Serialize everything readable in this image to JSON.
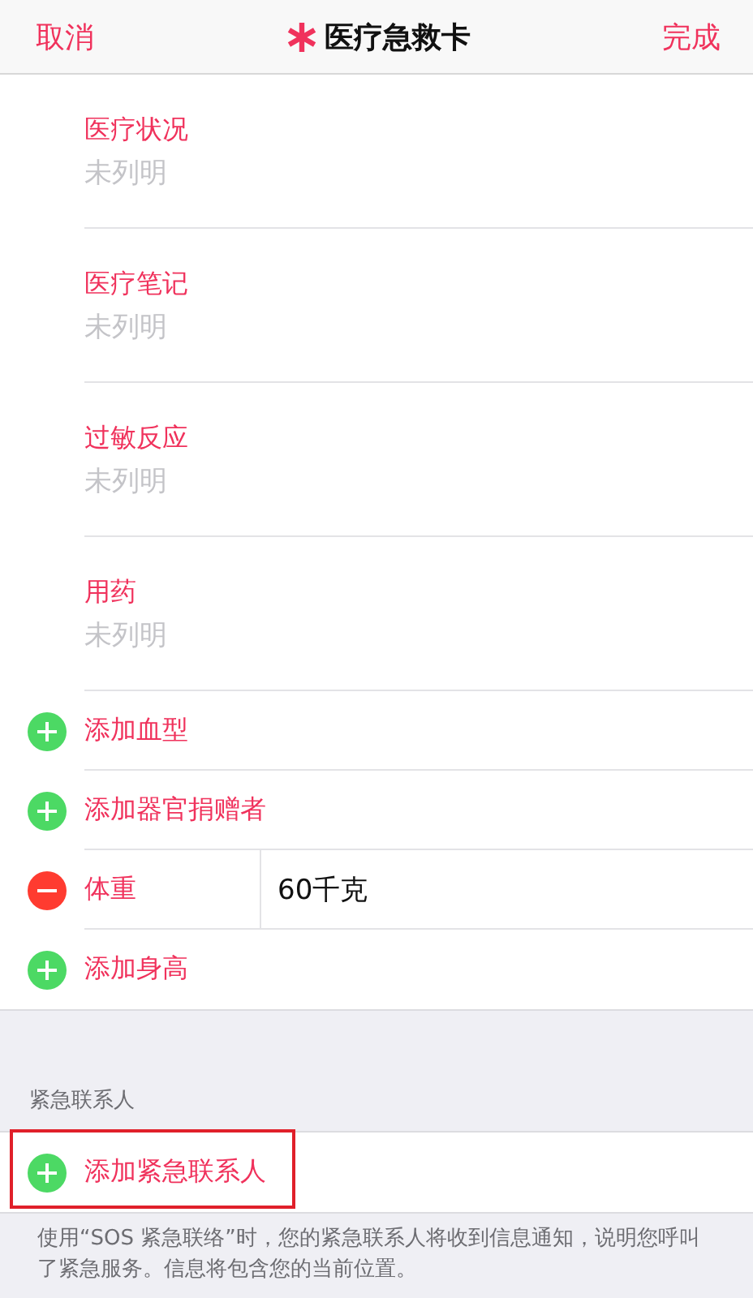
{
  "nav_bar": {
    "cancel": "取消",
    "title": "医疗急救卡",
    "done": "完成"
  },
  "fields": [
    {
      "label": "医疗状况",
      "placeholder": "未列明"
    },
    {
      "label": "医疗笔记",
      "placeholder": "未列明"
    },
    {
      "label": "过敏反应",
      "placeholder": "未列明"
    },
    {
      "label": "用药",
      "placeholder": "未列明"
    }
  ],
  "actions": [
    {
      "kind": "add",
      "label": "添加血型"
    },
    {
      "kind": "add",
      "label": "添加器官捐赠者"
    },
    {
      "kind": "remove",
      "label": "体重",
      "value": "60千克"
    },
    {
      "kind": "add",
      "label": "添加身高"
    }
  ],
  "emergency_contacts": {
    "header": "紧急联系人",
    "add_row": {
      "kind": "add",
      "label": "添加紧急联系人",
      "highlighted": true
    },
    "footer": "使用“SOS 紧急联络”时，您的紧急联系人将收到信息通知，说明您呼叫了紧急服务。信息将包含您的当前位置。"
  }
}
